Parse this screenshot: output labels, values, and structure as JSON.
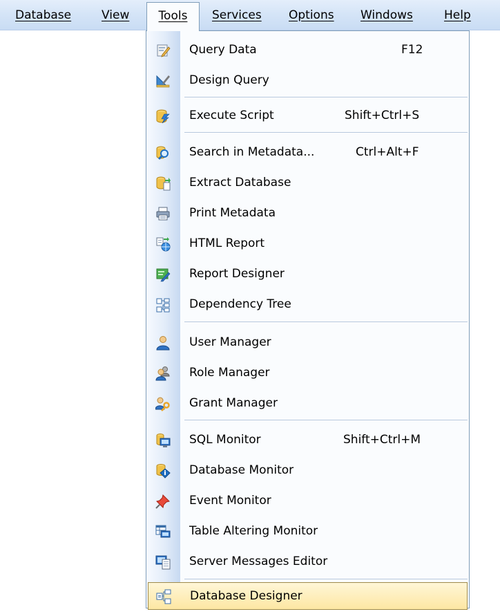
{
  "menubar": {
    "items": [
      {
        "label": "Database"
      },
      {
        "label": "View"
      },
      {
        "label": "Tools"
      },
      {
        "label": "Services"
      },
      {
        "label": "Options"
      },
      {
        "label": "Windows"
      },
      {
        "label": "Help"
      }
    ],
    "active": "Tools"
  },
  "tools_menu": {
    "items": [
      {
        "label": "Query Data",
        "shortcut": "F12",
        "icon": "query-data-icon"
      },
      {
        "label": "Design Query",
        "shortcut": "",
        "icon": "design-query-icon"
      },
      {
        "label": "Execute Script",
        "shortcut": "Shift+Ctrl+S",
        "icon": "execute-script-icon"
      },
      {
        "label": "Search in Metadata...",
        "shortcut": "Ctrl+Alt+F",
        "icon": "search-metadata-icon"
      },
      {
        "label": "Extract Database",
        "shortcut": "",
        "icon": "extract-database-icon"
      },
      {
        "label": "Print Metadata",
        "shortcut": "",
        "icon": "printer-icon"
      },
      {
        "label": "HTML Report",
        "shortcut": "",
        "icon": "html-report-icon"
      },
      {
        "label": "Report Designer",
        "shortcut": "",
        "icon": "report-designer-icon"
      },
      {
        "label": "Dependency Tree",
        "shortcut": "",
        "icon": "dependency-tree-icon"
      },
      {
        "label": "User Manager",
        "shortcut": "",
        "icon": "user-icon"
      },
      {
        "label": "Role Manager",
        "shortcut": "",
        "icon": "role-icon"
      },
      {
        "label": "Grant Manager",
        "shortcut": "",
        "icon": "grant-key-icon"
      },
      {
        "label": "SQL Monitor",
        "shortcut": "Shift+Ctrl+M",
        "icon": "sql-monitor-icon"
      },
      {
        "label": "Database Monitor",
        "shortcut": "",
        "icon": "database-info-icon"
      },
      {
        "label": "Event Monitor",
        "shortcut": "",
        "icon": "event-pin-icon"
      },
      {
        "label": "Table Altering Monitor",
        "shortcut": "",
        "icon": "table-monitor-icon"
      },
      {
        "label": "Server Messages Editor",
        "shortcut": "",
        "icon": "server-messages-icon"
      },
      {
        "label": "Database Designer",
        "shortcut": "",
        "icon": "database-designer-icon"
      }
    ],
    "highlighted": "Database Designer"
  },
  "colors": {
    "menubar_bg": "#d4e4f7",
    "menu_border": "#7f9db9",
    "highlight": "#fde7a3",
    "highlight_border": "#9e8a4a",
    "gutter": "#c7d9f1"
  }
}
